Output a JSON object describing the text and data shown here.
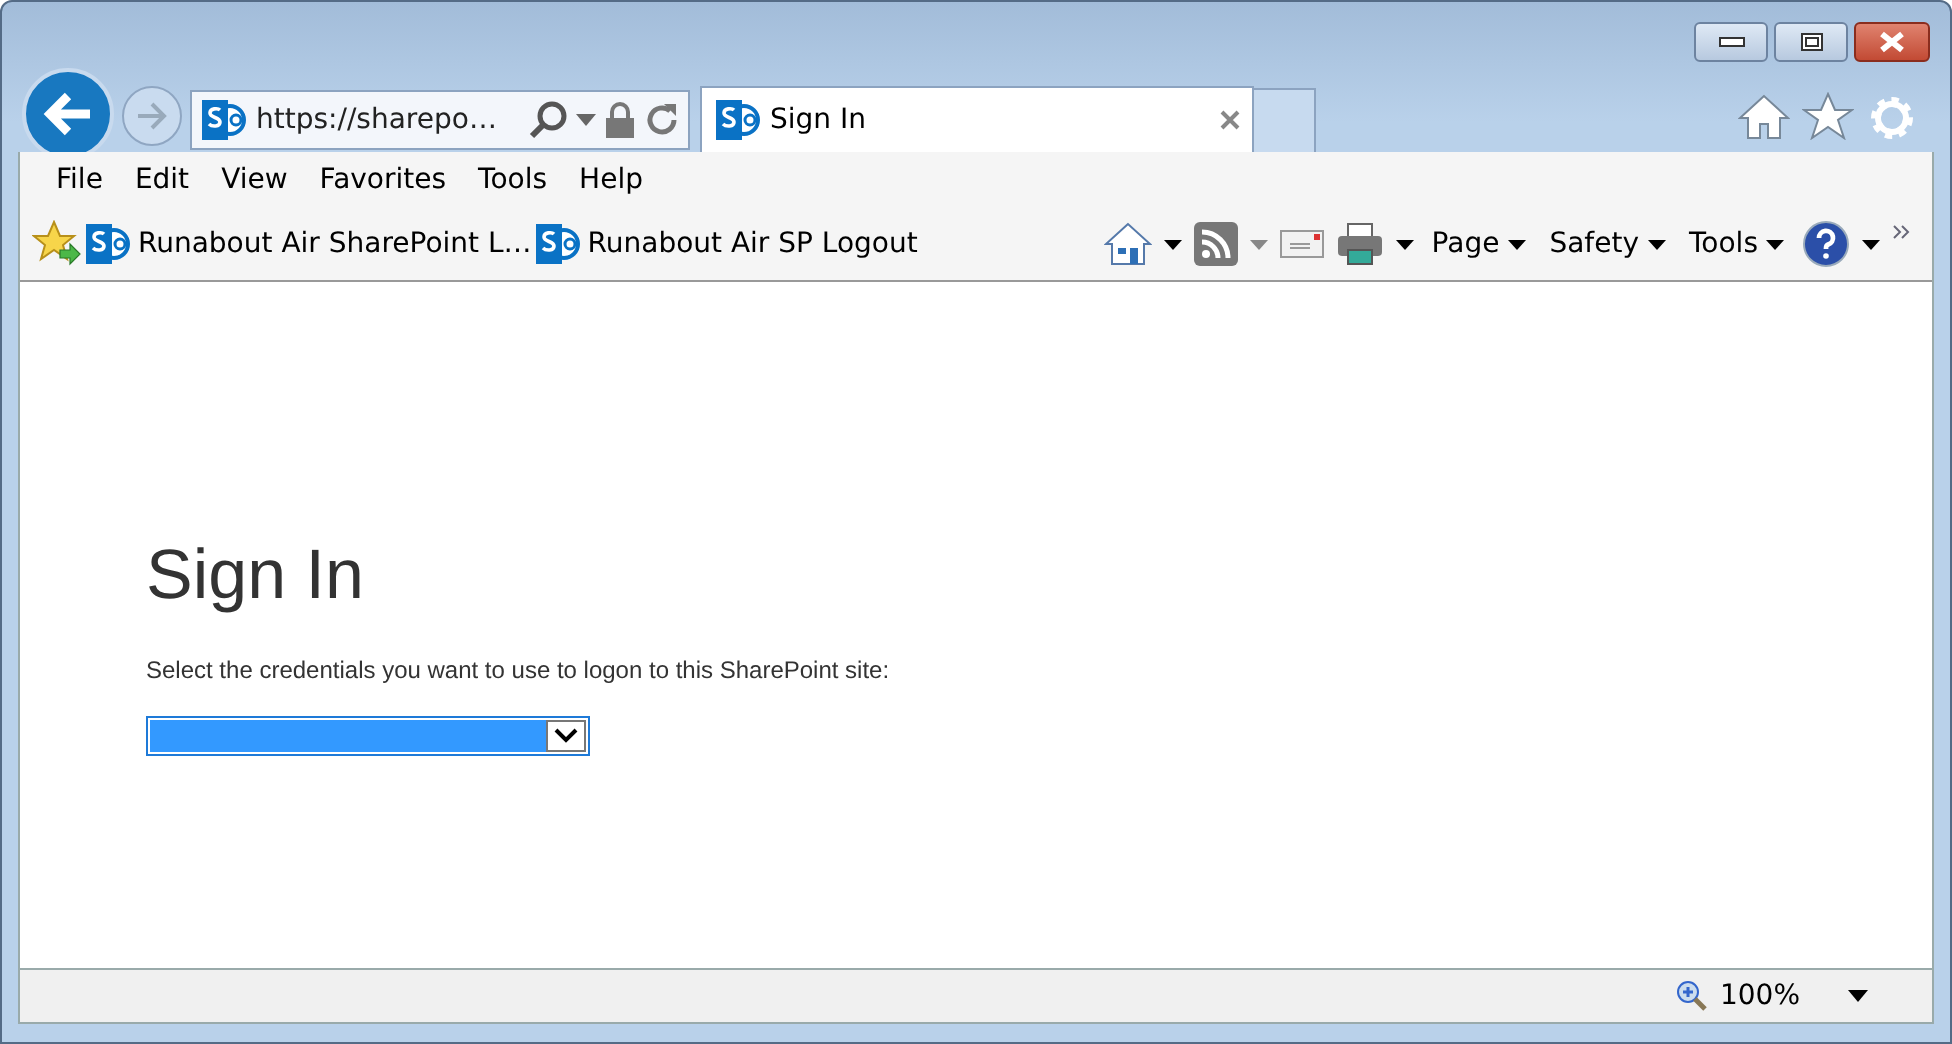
{
  "address_bar": {
    "url": "https://sharepo…"
  },
  "tab": {
    "title": "Sign In",
    "selected": true
  },
  "menu_bar": [
    "File",
    "Edit",
    "View",
    "Favorites",
    "Tools",
    "Help"
  ],
  "favorites_bar": [
    {
      "label": "Runabout Air SharePoint L…"
    },
    {
      "label": "Runabout Air SP Logout"
    }
  ],
  "command_bar": [
    "Page",
    "Safety",
    "Tools"
  ],
  "page": {
    "heading": "Sign In",
    "prompt": "Select the credentials you want to use to logon to this SharePoint site:",
    "credentials_select": {
      "highlighted": true
    }
  },
  "status_bar": {
    "zoom": "100%"
  }
}
